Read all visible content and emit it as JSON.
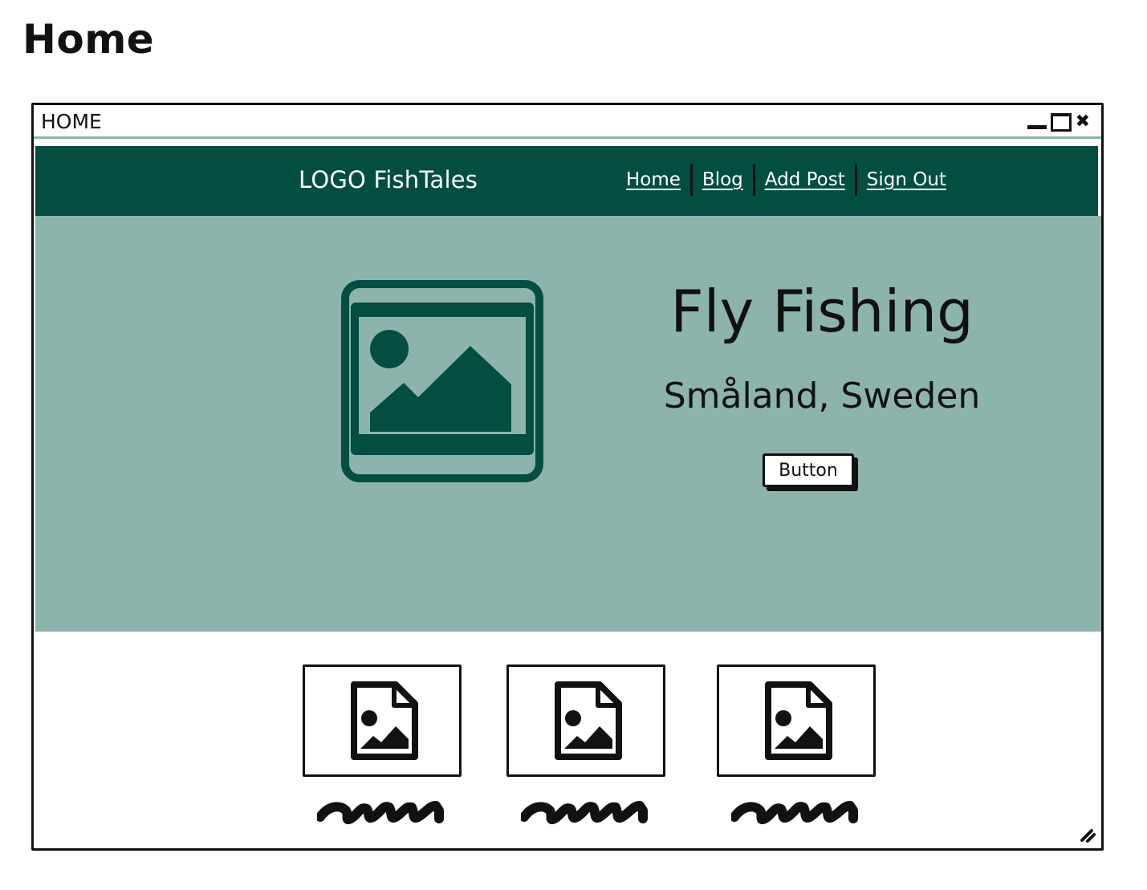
{
  "page": {
    "heading": "Home"
  },
  "window": {
    "title": "HOME",
    "controls": {
      "minimize": "minimize-icon",
      "maximize": "maximize-icon",
      "close": "close-icon"
    }
  },
  "navbar": {
    "logo": "LOGO FishTales",
    "links": [
      {
        "label": "Home"
      },
      {
        "label": "Blog"
      },
      {
        "label": "Add Post"
      },
      {
        "label": "Sign Out"
      }
    ]
  },
  "hero": {
    "image_icon": "image-placeholder-icon",
    "title": "Fly Fishing",
    "subtitle": "Småland, Sweden",
    "button_label": "Button"
  },
  "cards": [
    {
      "icon": "image-file-icon"
    },
    {
      "icon": "image-file-icon"
    },
    {
      "icon": "image-file-icon"
    }
  ],
  "colors": {
    "navbar_bg": "#034e41",
    "hero_bg": "#8db4ac",
    "icon_fill": "#034e41",
    "ink": "#111111",
    "page_bg": "#ffffff"
  }
}
